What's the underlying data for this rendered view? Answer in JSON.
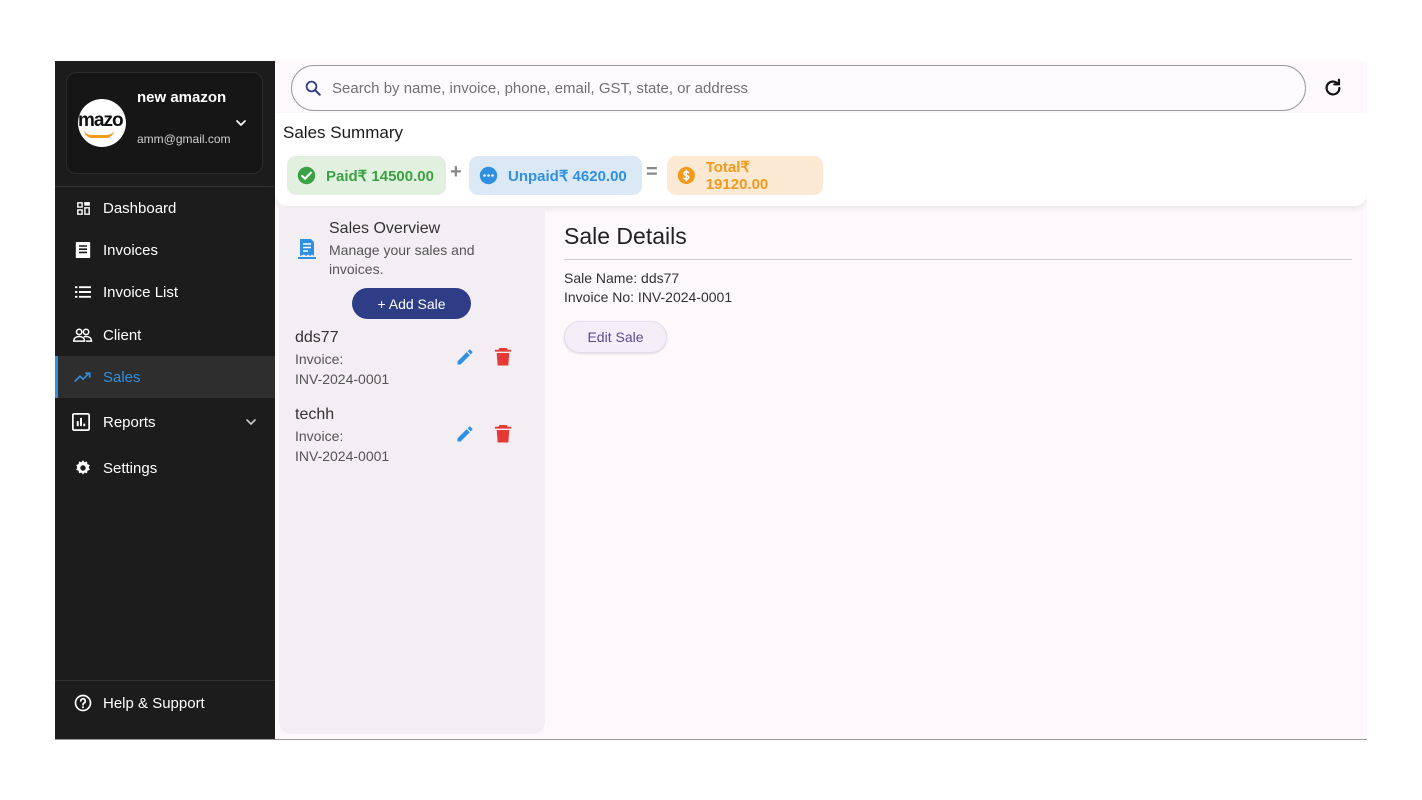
{
  "account": {
    "avatar_text": "mazo",
    "name": "new amazon",
    "email": "amm@gmail.com"
  },
  "nav": {
    "dashboard": "Dashboard",
    "invoices": "Invoices",
    "invoice_list": "Invoice List",
    "client": "Client",
    "sales": "Sales",
    "reports": "Reports",
    "settings": "Settings",
    "help": "Help & Support"
  },
  "search": {
    "placeholder": "Search by name, invoice, phone, email, GST, state, or address"
  },
  "summary": {
    "title": "Sales Summary",
    "paid": "Paid₹ 14500.00",
    "unpaid": "Unpaid₹ 4620.00",
    "total": "Total₹ 19120.00",
    "op_plus": "+",
    "op_equals": "="
  },
  "overview": {
    "title": "Sales Overview",
    "subtitle": "Manage your sales and invoices.",
    "add_button": "+ Add Sale",
    "invoice_label": "Invoice:",
    "items": [
      {
        "name": "dds77",
        "invoice": "INV-2024-0001"
      },
      {
        "name": "techh",
        "invoice": "INV-2024-0001"
      }
    ]
  },
  "details": {
    "title": "Sale Details",
    "sale_name": "Sale Name: dds77",
    "invoice_no": "Invoice No: INV-2024-0001",
    "edit_button": "Edit Sale"
  },
  "colors": {
    "sidebar_bg": "#1c1c1c",
    "active_accent": "#2f8fe0",
    "paid": "#3aa145",
    "unpaid": "#2f8fe0",
    "total": "#f29a1a",
    "primary_button": "#2e3d86",
    "delete": "#e53935"
  }
}
